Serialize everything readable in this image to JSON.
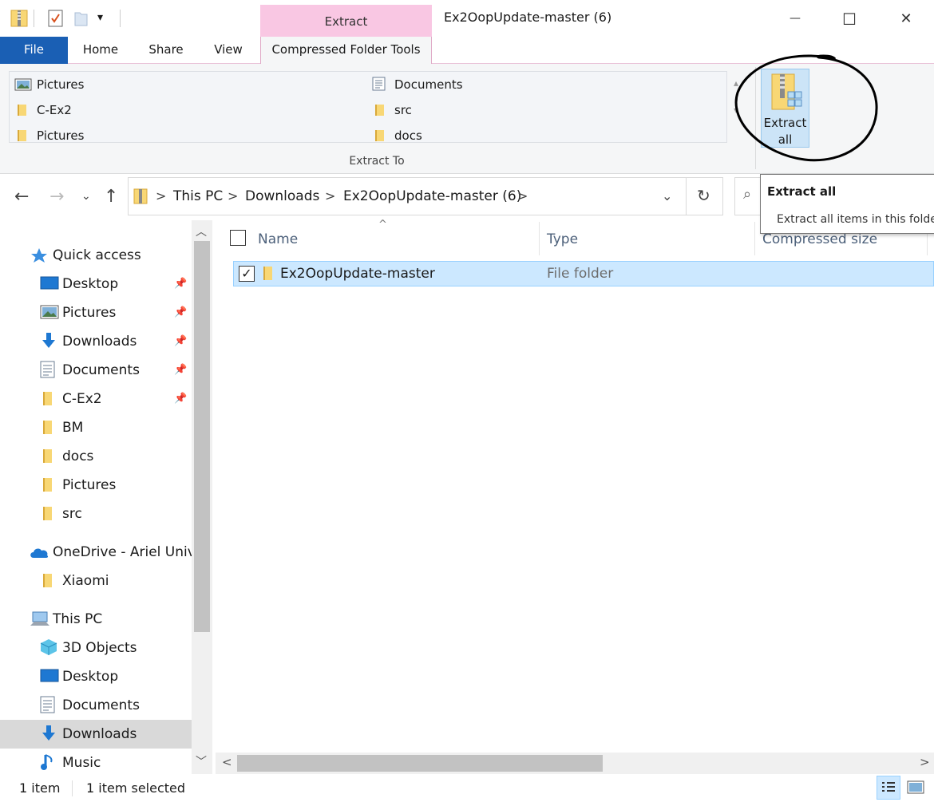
{
  "window": {
    "title": "Ex2OopUpdate-master (6)",
    "context_tab": "Extract",
    "controls": {
      "minimize": "—",
      "maximize": "☐",
      "close": "✕"
    }
  },
  "quick_access_toolbar": {
    "dropdown": "▾"
  },
  "ribbon_tabs": [
    "File",
    "Home",
    "Share",
    "View",
    "Compressed Folder Tools"
  ],
  "ribbon": {
    "extract_to_items": [
      {
        "label": "Pictures",
        "icon": "pictures-icon"
      },
      {
        "label": "Documents",
        "icon": "documents-icon"
      },
      {
        "label": "C-Ex2",
        "icon": "folder-icon"
      },
      {
        "label": "src",
        "icon": "folder-icon"
      },
      {
        "label": "Pictures",
        "icon": "folder-icon"
      },
      {
        "label": "docs",
        "icon": "folder-icon"
      }
    ],
    "group_label": "Extract To",
    "extract_all_line1": "Extract",
    "extract_all_line2": "all"
  },
  "tooltip": {
    "title": "Extract all",
    "description": "Extract all items in this folder"
  },
  "address_bar": {
    "breadcrumbs": [
      "This PC",
      "Downloads",
      "Ex2OopUpdate-master (6)"
    ],
    "separator": ">"
  },
  "nav_pane": {
    "quick_access_label": "Quick access",
    "quick_access_items": [
      {
        "label": "Desktop",
        "pinned": true
      },
      {
        "label": "Pictures",
        "pinned": true
      },
      {
        "label": "Downloads",
        "pinned": true
      },
      {
        "label": "Documents",
        "pinned": true
      },
      {
        "label": "C-Ex2",
        "pinned": true
      },
      {
        "label": "BM",
        "pinned": false
      },
      {
        "label": "docs",
        "pinned": false
      },
      {
        "label": "Pictures",
        "pinned": false
      },
      {
        "label": "src",
        "pinned": false
      }
    ],
    "onedrive_label": "OneDrive - Ariel Unive",
    "onedrive_items": [
      {
        "label": "Xiaomi"
      }
    ],
    "this_pc_label": "This PC",
    "this_pc_items": [
      {
        "label": "3D Objects"
      },
      {
        "label": "Desktop"
      },
      {
        "label": "Documents"
      },
      {
        "label": "Downloads",
        "selected": true
      },
      {
        "label": "Music"
      }
    ]
  },
  "file_list": {
    "columns": [
      "Name",
      "Type",
      "Compressed size"
    ],
    "rows": [
      {
        "name": "Ex2OopUpdate-master",
        "type": "File folder",
        "selected": true,
        "checked": true
      }
    ]
  },
  "status_bar": {
    "item_count": "1 item",
    "selection": "1 item selected"
  },
  "colors": {
    "accent": "#1a5fb4",
    "context_tab": "#f9c7e3",
    "selection": "#cce8ff",
    "folder": "#f8d775"
  }
}
